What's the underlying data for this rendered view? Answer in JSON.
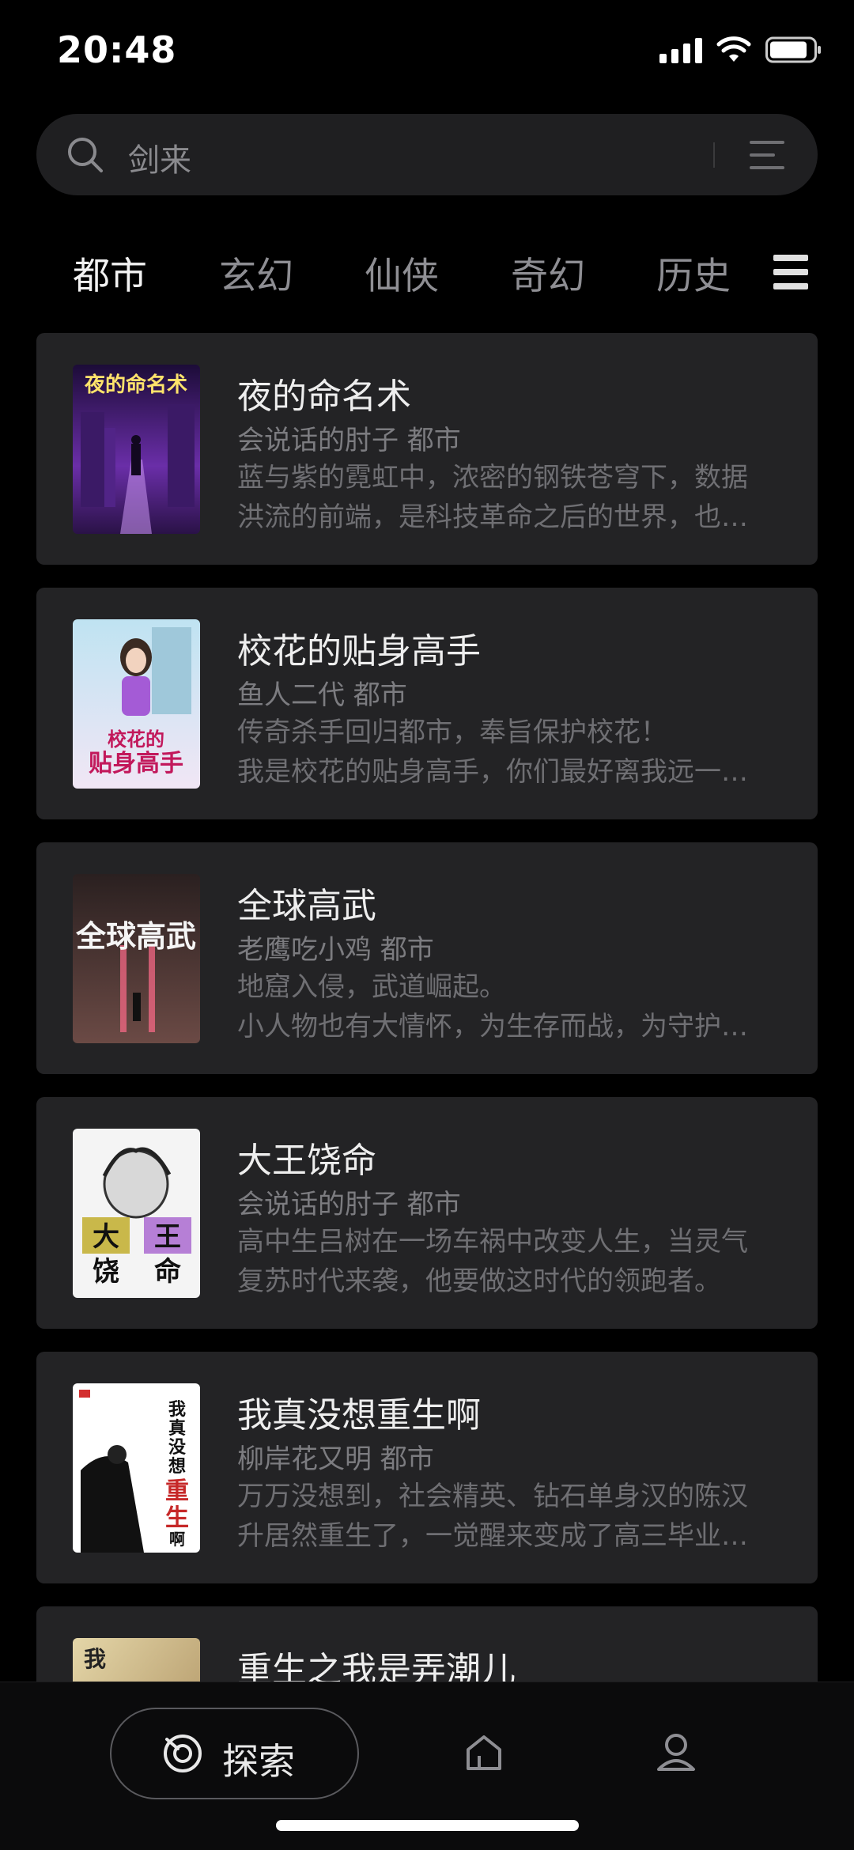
{
  "status_bar": {
    "time": "20:48"
  },
  "search": {
    "placeholder": "剑来"
  },
  "tabs": [
    {
      "label": "都市",
      "active": true
    },
    {
      "label": "玄幻",
      "active": false
    },
    {
      "label": "仙侠",
      "active": false
    },
    {
      "label": "奇幻",
      "active": false
    },
    {
      "label": "历史",
      "active": false
    }
  ],
  "books": [
    {
      "title": "夜的命名术",
      "author": "会说话的肘子",
      "category": "都市",
      "meta": "会说话的肘子 都市",
      "desc": [
        "蓝与紫的霓虹中，浓密的钢铁苍穹下，数据",
        "洪流的前端，是科技革命之后的世界，也…"
      ],
      "cover_text": "夜的命名术",
      "cover_colors": [
        "#2a1247",
        "#7b3fb4"
      ]
    },
    {
      "title": "校花的贴身高手",
      "author": "鱼人二代",
      "category": "都市",
      "meta": "鱼人二代 都市",
      "desc": [
        "传奇杀手回归都市，奉旨保护校花！",
        "我是校花的贴身高手，你们最好离我远一…"
      ],
      "cover_text": "校花的贴身高手",
      "cover_colors": [
        "#bfe3f2",
        "#d9b4e6"
      ]
    },
    {
      "title": "全球高武",
      "author": "老鹰吃小鸡",
      "category": "都市",
      "meta": "老鹰吃小鸡 都市",
      "desc": [
        "地窟入侵，武道崛起。",
        "小人物也有大情怀，为生存而战，为守护…"
      ],
      "cover_text": "全球高武",
      "cover_colors": [
        "#3a2a2a",
        "#8c5a55"
      ]
    },
    {
      "title": "大王饶命",
      "author": "会说话的肘子",
      "category": "都市",
      "meta": "会说话的肘子 都市",
      "desc": [
        "高中生吕树在一场车祸中改变人生，当灵气",
        "复苏时代来袭，他要做这时代的领跑者。"
      ],
      "cover_text": "大王饶命",
      "cover_colors": [
        "#f3f3f3",
        "#cfcfcf"
      ]
    },
    {
      "title": "我真没想重生啊",
      "author": "柳岸花又明",
      "category": "都市",
      "meta": "柳岸花又明 都市",
      "desc": [
        "万万没想到，社会精英、钻石单身汉的陈汉",
        "升居然重生了，一觉醒来变成了高三毕业…"
      ],
      "cover_text": "我真没想重生啊",
      "cover_colors": [
        "#ffffff",
        "#e8e8e8"
      ]
    },
    {
      "title": "重生之我是弄潮儿",
      "author": "",
      "category": "",
      "meta": "",
      "desc": [
        "",
        ""
      ],
      "cover_text": "我",
      "cover_colors": [
        "#d8c79a",
        "#b59a66"
      ]
    }
  ],
  "bottom_nav": {
    "explore_label": "探索",
    "items": [
      "explore",
      "home",
      "profile"
    ]
  },
  "colors": {
    "background": "#000000",
    "card": "#232325",
    "search_bg": "#1f1f21",
    "text_primary": "#eeeeee",
    "text_secondary": "#7c7c80"
  }
}
